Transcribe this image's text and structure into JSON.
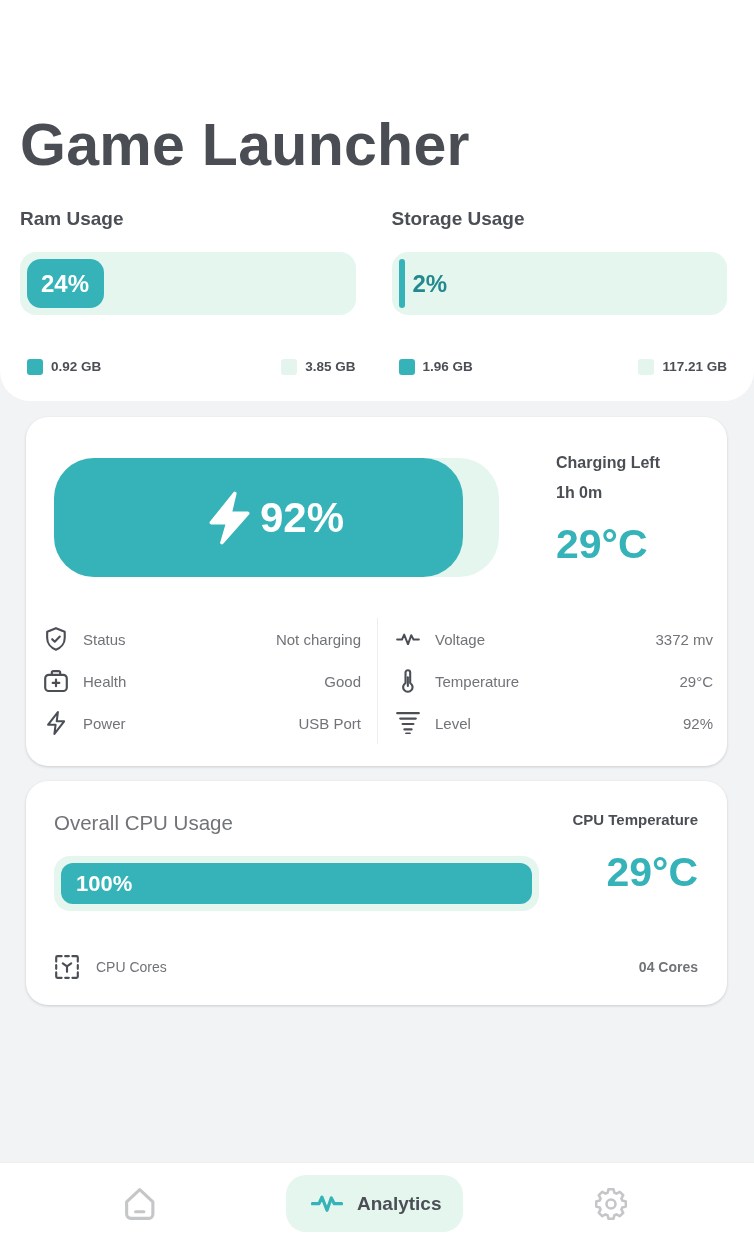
{
  "header": {
    "title": "Game Launcher"
  },
  "usage": [
    {
      "label": "Ram Usage",
      "level": 0.24,
      "percent": "24%",
      "legend": [
        {
          "value": "0.92 GB",
          "color": "#35b3b8"
        },
        {
          "value": "3.85 GB",
          "color": "#e4f5ee"
        }
      ]
    },
    {
      "label": "Storage Usage",
      "level": 0.02,
      "percent": "2%",
      "legend": [
        {
          "value": "1.96 GB",
          "color": "#35b3b8"
        },
        {
          "value": "117.21 GB",
          "color": "#e4f5ee"
        }
      ]
    }
  ],
  "battery": {
    "level": 0.92,
    "percent": "92%",
    "charging_left_label": "Charging Left",
    "charging_left": "1h 0m",
    "temperature": "29°C",
    "detail_columns": [
      {
        "rows": [
          {
            "label": "Status",
            "value": "Not charging"
          },
          {
            "label": "Health",
            "value": "Good"
          },
          {
            "label": "Power",
            "value": "USB Port"
          }
        ]
      },
      {
        "rows": [
          {
            "label": "Voltage",
            "value": "3372 mv"
          },
          {
            "label": "Temperature",
            "value": "29°C"
          },
          {
            "label": "Level",
            "value": "92%"
          }
        ]
      }
    ]
  },
  "cpu": {
    "title": "Overall CPU Usage",
    "level": 1,
    "percent": "100%",
    "temperature_label": "CPU Temperature",
    "temperature": "29°C",
    "cores_label": "CPU Cores",
    "cores": "04 Cores"
  },
  "nav": {
    "items": [
      {
        "selected": false
      },
      {
        "label": "Analytics",
        "selected": true
      },
      {
        "selected": false
      }
    ]
  }
}
